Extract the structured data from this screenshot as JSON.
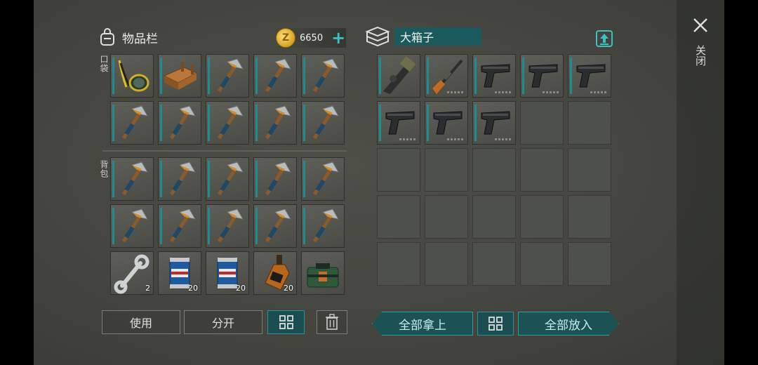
{
  "inventory": {
    "title": "物品栏",
    "coins": "6650",
    "plus_label": "+",
    "pocket_label": "口袋",
    "backpack_label": "背包",
    "pocket_slots": [
      {
        "item": "scuba-mask",
        "qty": ""
      },
      {
        "item": "workbench",
        "qty": ""
      },
      {
        "item": "pickaxe",
        "qty": ""
      },
      {
        "item": "pickaxe",
        "qty": ""
      },
      {
        "item": "pickaxe",
        "qty": ""
      },
      {
        "item": "pickaxe",
        "qty": ""
      },
      {
        "item": "pickaxe",
        "qty": ""
      },
      {
        "item": "pickaxe",
        "qty": ""
      },
      {
        "item": "pickaxe",
        "qty": ""
      },
      {
        "item": "pickaxe",
        "qty": ""
      }
    ],
    "backpack_slots": [
      {
        "item": "pickaxe",
        "qty": ""
      },
      {
        "item": "pickaxe",
        "qty": ""
      },
      {
        "item": "pickaxe",
        "qty": ""
      },
      {
        "item": "pickaxe",
        "qty": ""
      },
      {
        "item": "pickaxe",
        "qty": ""
      },
      {
        "item": "pickaxe",
        "qty": ""
      },
      {
        "item": "pickaxe",
        "qty": ""
      },
      {
        "item": "pickaxe",
        "qty": ""
      },
      {
        "item": "pickaxe",
        "qty": ""
      },
      {
        "item": "pickaxe",
        "qty": ""
      },
      {
        "item": "wrench",
        "qty": "2"
      },
      {
        "item": "beer-can",
        "qty": "20"
      },
      {
        "item": "beer-can",
        "qty": "20"
      },
      {
        "item": "whiskey-bottle",
        "qty": "20"
      },
      {
        "item": "explosive-bag",
        "qty": ""
      }
    ],
    "buttons": {
      "use": "使用",
      "split": "分开"
    }
  },
  "chest": {
    "title": "大箱子",
    "slots": [
      {
        "item": "grenade-launcher"
      },
      {
        "item": "hunting-rifle"
      },
      {
        "item": "pistol"
      },
      {
        "item": "pistol"
      },
      {
        "item": "pistol"
      },
      {
        "item": "pistol"
      },
      {
        "item": "pistol"
      },
      {
        "item": "pistol"
      }
    ],
    "buttons": {
      "take_all": "全部拿上",
      "put_all": "全部放入"
    }
  },
  "close_label": "关闭",
  "colors": {
    "accent": "#1f8c95",
    "teal_button": "#1c5254",
    "coin": "#d6a01f"
  }
}
